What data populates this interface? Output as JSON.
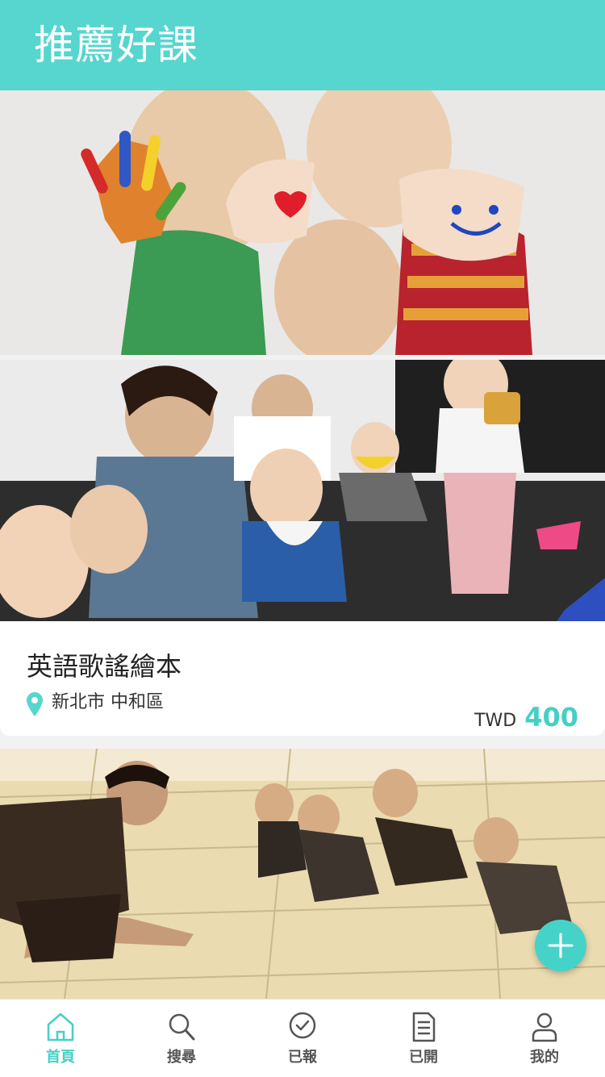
{
  "header": {
    "title": "推薦好課"
  },
  "banner_images": [
    {
      "alt": "children-painted-hands"
    },
    {
      "alt": "toddler-music-class"
    },
    {
      "alt": "kids-movement-class"
    }
  ],
  "course_card": {
    "title": "英語歌謠繪本",
    "location": "新北市 中和區",
    "currency": "TWD",
    "price": "400"
  },
  "fab": {
    "icon": "plus-icon"
  },
  "tabbar": {
    "tabs": [
      {
        "label": "首頁",
        "icon": "home-icon",
        "active": true
      },
      {
        "label": "搜尋",
        "icon": "search-icon",
        "active": false
      },
      {
        "label": "已報",
        "icon": "check-circle-icon",
        "active": false
      },
      {
        "label": "已開",
        "icon": "document-icon",
        "active": false
      },
      {
        "label": "我的",
        "icon": "user-icon",
        "active": false
      }
    ]
  },
  "colors": {
    "accent": "#56d6cf",
    "price": "#45cfc6"
  }
}
